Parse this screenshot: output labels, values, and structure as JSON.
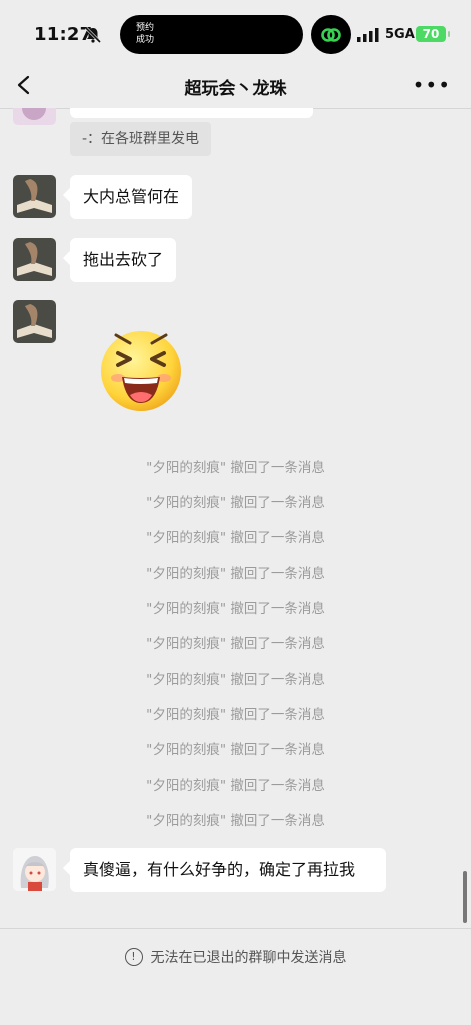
{
  "status_bar": {
    "time": "11:27",
    "island_text_line1": "预约",
    "island_text_line2": "成功",
    "network": "5GA",
    "battery": "70"
  },
  "nav": {
    "title": "超玩会丶龙珠",
    "more": "•••"
  },
  "chat": {
    "quote_text": "-：在各班群里发电",
    "messages": [
      {
        "text": "大内总管何在"
      },
      {
        "text": "拖出去砍了"
      },
      {
        "text": "真傻逼，有什么好争的，确定了再拉我"
      }
    ],
    "recall_notices": [
      "\"夕阳的刻痕\" 撤回了一条消息",
      "\"夕阳的刻痕\" 撤回了一条消息",
      "\"夕阳的刻痕\" 撤回了一条消息",
      "\"夕阳的刻痕\" 撤回了一条消息",
      "\"夕阳的刻痕\" 撤回了一条消息",
      "\"夕阳的刻痕\" 撤回了一条消息",
      "\"夕阳的刻痕\" 撤回了一条消息",
      "\"夕阳的刻痕\" 撤回了一条消息",
      "\"夕阳的刻痕\" 撤回了一条消息",
      "\"夕阳的刻痕\" 撤回了一条消息",
      "\"夕阳的刻痕\" 撤回了一条消息"
    ]
  },
  "footer": {
    "notice": "无法在已退出的群聊中发送消息"
  },
  "colors": {
    "background": "#ededed",
    "bubble": "#ffffff",
    "battery": "#4cd964",
    "system_text": "#9b9b9b"
  }
}
